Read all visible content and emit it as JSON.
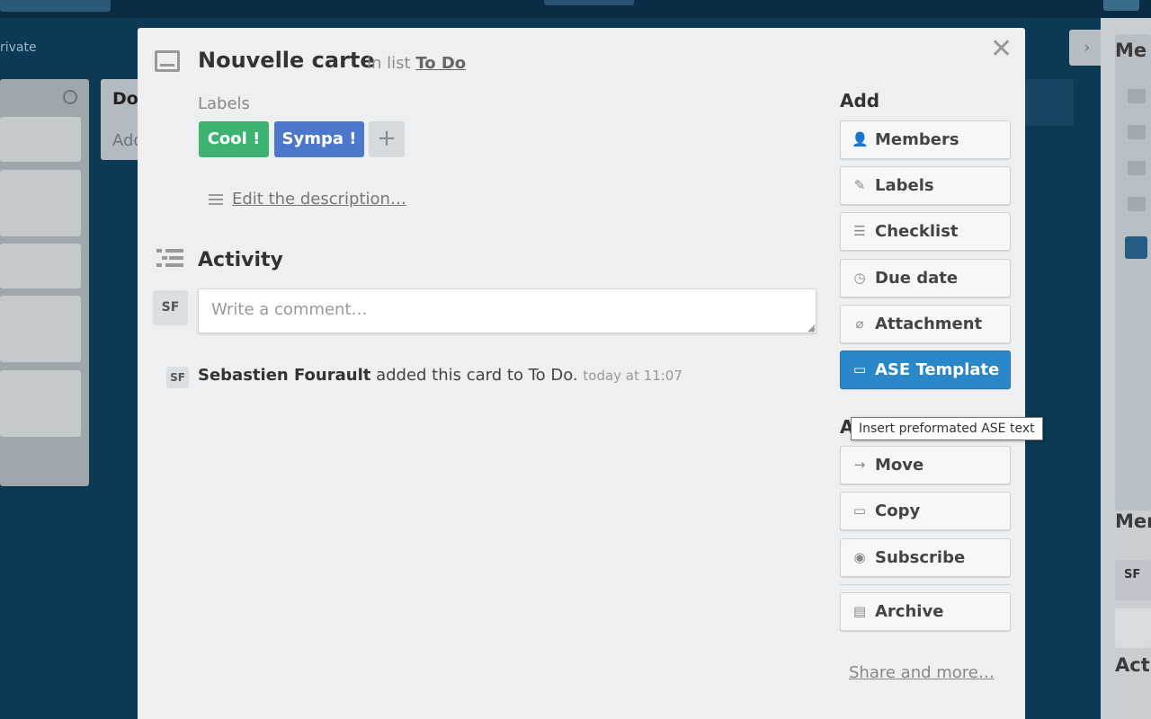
{
  "board": {
    "visibility": "rivate",
    "list_b_title": "Do",
    "list_b_add": "Add",
    "sidebar_heading_1": "Me",
    "sidebar_heading_2": "Mer",
    "sidebar_heading_3": "Acti",
    "sidebar_avatar": "SF"
  },
  "card": {
    "title": "Nouvelle carte",
    "in_list_prefix": "in list",
    "list_name": "To Do",
    "labels_heading": "Labels",
    "labels": [
      {
        "text": "Cool !",
        "color": "#3cb371"
      },
      {
        "text": "Sympa !",
        "color": "#4d77cb"
      }
    ],
    "add_label": "+",
    "edit_description": "Edit the description…",
    "activity_heading": "Activity",
    "comment_avatar": "SF",
    "comment_placeholder": "Write a comment…",
    "activity_items": [
      {
        "avatar": "SF",
        "user": "Sebastien Fourault",
        "action": "added this card to To Do.",
        "time": "today at 11:07"
      }
    ]
  },
  "side": {
    "add_heading": "Add",
    "add_buttons": [
      {
        "label": "Members",
        "icon": "person-icon"
      },
      {
        "label": "Labels",
        "icon": "tag-icon"
      },
      {
        "label": "Checklist",
        "icon": "checklist-icon"
      },
      {
        "label": "Due date",
        "icon": "clock-icon"
      },
      {
        "label": "Attachment",
        "icon": "paperclip-icon"
      },
      {
        "label": "ASE Template",
        "icon": "card-icon"
      }
    ],
    "actions_heading": "A",
    "action_buttons": [
      {
        "label": "Move",
        "icon": "arrow-right-icon"
      },
      {
        "label": "Copy",
        "icon": "card-icon"
      },
      {
        "label": "Subscribe",
        "icon": "eye-icon"
      }
    ],
    "archive_label": "Archive",
    "share_link": "Share and more…",
    "tooltip": "Insert preformated ASE text",
    "primary_color": "#2b88c8"
  }
}
